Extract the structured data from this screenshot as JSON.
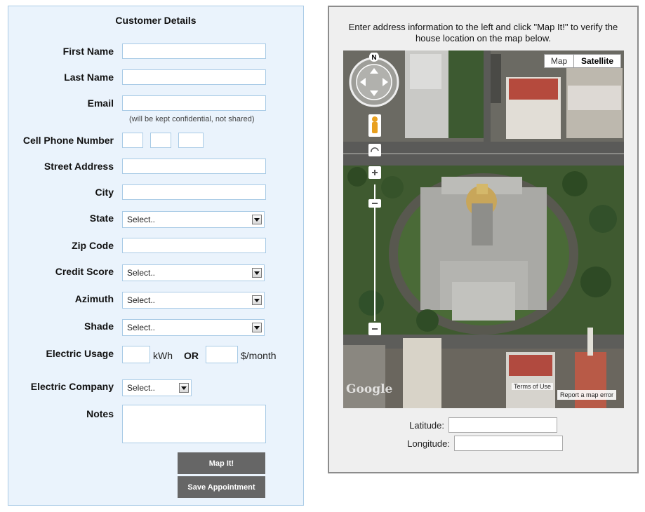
{
  "form": {
    "title": "Customer Details",
    "first_name_label": "First Name",
    "last_name_label": "Last Name",
    "email_label": "Email",
    "email_note": "(will be kept confidential, not shared)",
    "cell_phone_label": "Cell Phone Number",
    "street_label": "Street Address",
    "city_label": "City",
    "state_label": "State",
    "state_value": "Select..",
    "zip_label": "Zip Code",
    "credit_label": "Credit Score",
    "credit_value": "Select..",
    "azimuth_label": "Azimuth",
    "azimuth_value": "Select..",
    "shade_label": "Shade",
    "shade_value": "Select..",
    "usage_label": "Electric Usage",
    "kwh_unit": "kWh",
    "or_text": "OR",
    "month_unit": "$/month",
    "company_label": "Electric Company",
    "company_value": "Select..",
    "notes_label": "Notes",
    "map_button": "Map It!",
    "save_button": "Save Appointment"
  },
  "map": {
    "instructions": "Enter address information to the left and click \"Map It!\" to verify the house location on the map below.",
    "map_tab": "Map",
    "satellite_tab": "Satellite",
    "compass_letter": "N",
    "terms": "Terms of Use",
    "report": "Report a map error",
    "logo": "Google",
    "latitude_label": "Latitude:",
    "longitude_label": "Longitude:"
  },
  "colors": {
    "form_bg": "#eaf3fc",
    "form_border": "#a9cbe6",
    "button_bg": "#666666",
    "map_panel_bg": "#efefef"
  }
}
